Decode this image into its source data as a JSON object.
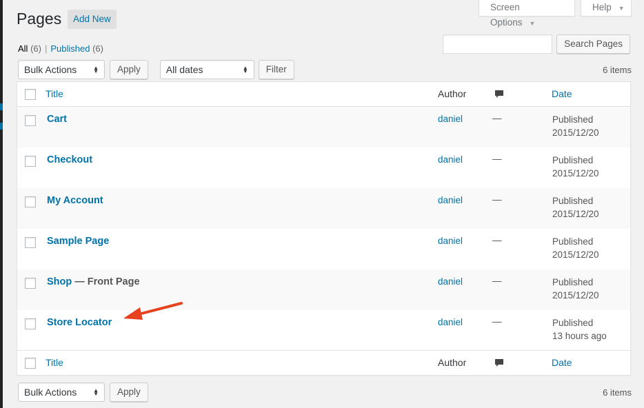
{
  "screen_meta": {
    "screen_options": "Screen Options",
    "help": "Help"
  },
  "header": {
    "title": "Pages",
    "add_new": "Add New"
  },
  "views": {
    "all": "All",
    "all_count": "(6)",
    "separator": "|",
    "published": "Published",
    "published_count": "(6)"
  },
  "search": {
    "button": "Search Pages"
  },
  "tablenav_top": {
    "bulk_actions": "Bulk Actions",
    "apply": "Apply",
    "dates": "All dates",
    "filter": "Filter",
    "items": "6 items"
  },
  "tablenav_bottom": {
    "bulk_actions": "Bulk Actions",
    "apply": "Apply",
    "items": "6 items"
  },
  "columns": {
    "title": "Title",
    "author": "Author",
    "comments_icon": "comment-bubble-icon",
    "date": "Date"
  },
  "rows": [
    {
      "title": "Cart",
      "state": "",
      "author": "daniel",
      "comments": "—",
      "status": "Published",
      "date": "2015/12/20"
    },
    {
      "title": "Checkout",
      "state": "",
      "author": "daniel",
      "comments": "—",
      "status": "Published",
      "date": "2015/12/20"
    },
    {
      "title": "My Account",
      "state": "",
      "author": "daniel",
      "comments": "—",
      "status": "Published",
      "date": "2015/12/20"
    },
    {
      "title": "Sample Page",
      "state": "",
      "author": "daniel",
      "comments": "—",
      "status": "Published",
      "date": "2015/12/20"
    },
    {
      "title": "Shop",
      "state": " — Front Page",
      "author": "daniel",
      "comments": "—",
      "status": "Published",
      "date": "2015/12/20"
    },
    {
      "title": "Store Locator",
      "state": "",
      "author": "daniel",
      "comments": "—",
      "status": "Published",
      "date": "13 hours ago"
    }
  ],
  "annotation": {
    "arrow_color": "#e8411e"
  },
  "colors": {
    "link": "#0073aa",
    "background": "#f1f1f1",
    "row_alt": "#f9f9f9"
  }
}
